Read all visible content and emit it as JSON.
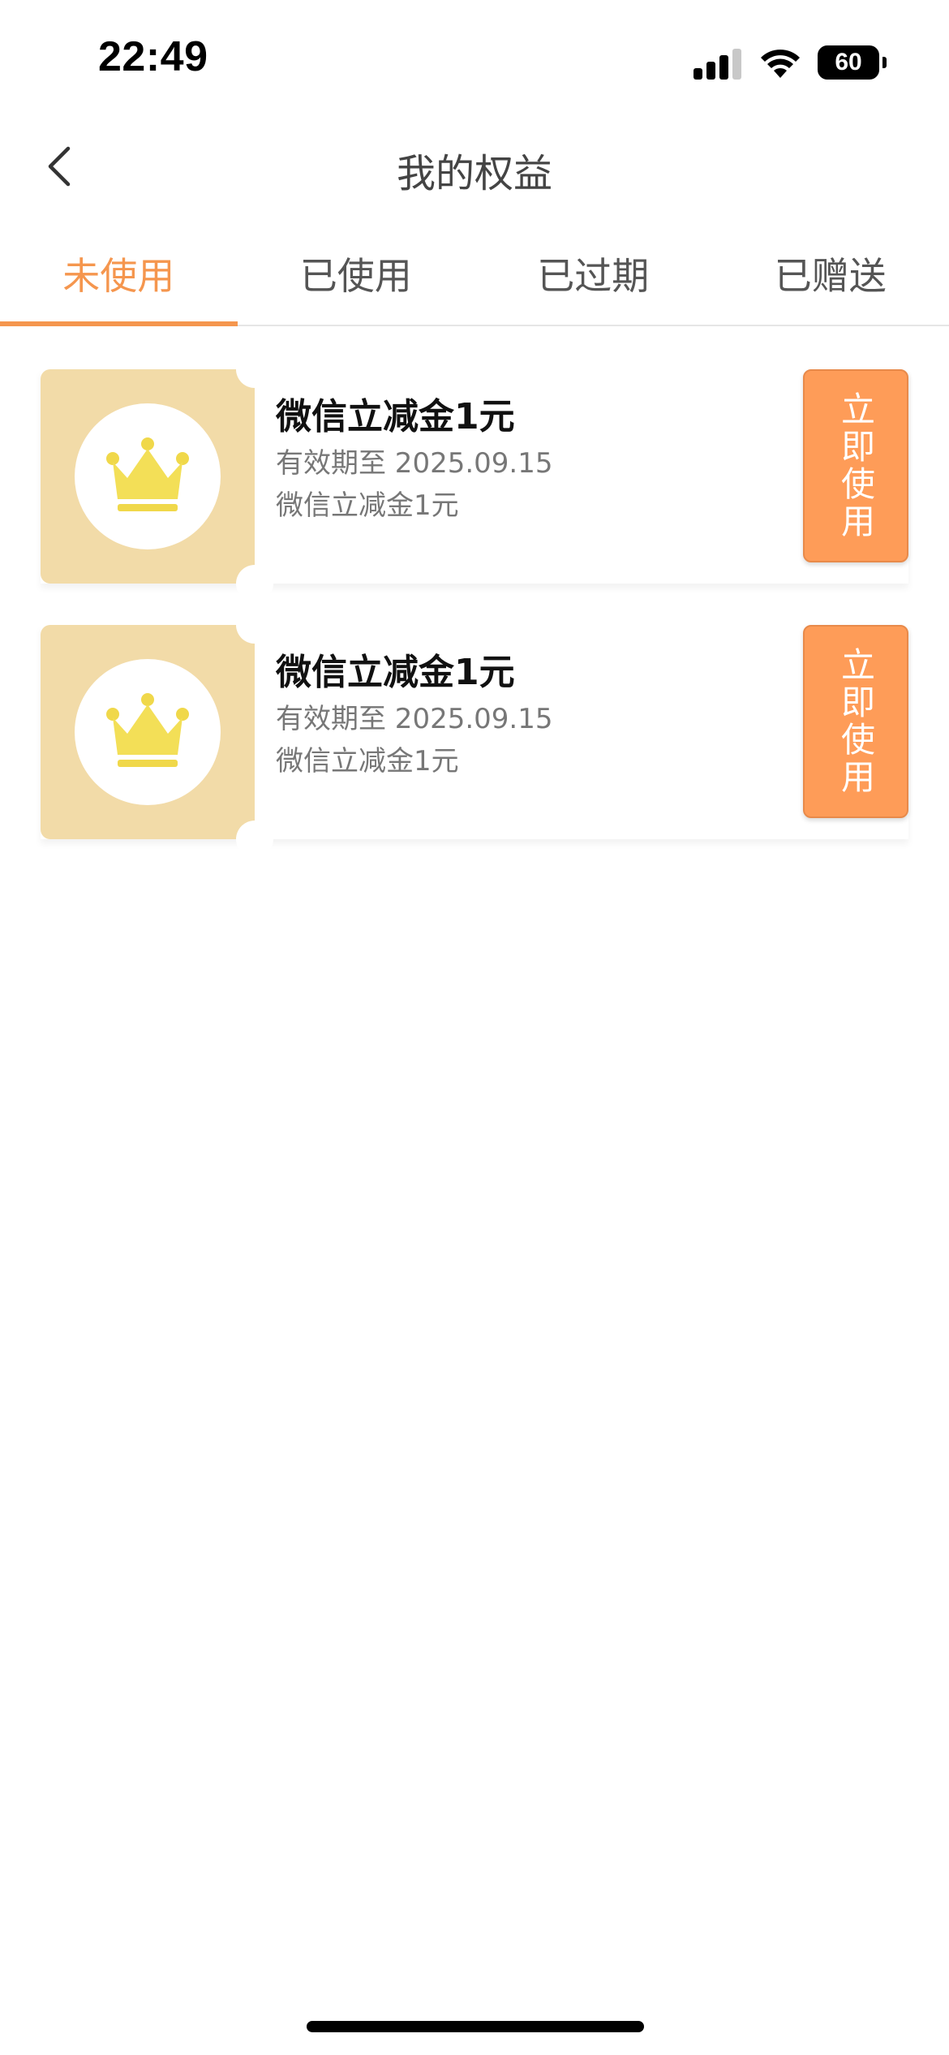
{
  "status_bar": {
    "time": "22:49",
    "battery": "60"
  },
  "nav": {
    "title": "我的权益"
  },
  "tabs": [
    {
      "label": "未使用",
      "active": true
    },
    {
      "label": "已使用",
      "active": false
    },
    {
      "label": "已过期",
      "active": false
    },
    {
      "label": "已赠送",
      "active": false
    }
  ],
  "coupons": [
    {
      "title": "微信立减金1元",
      "expiry": "有效期至 2025.09.15",
      "description": "微信立减金1元",
      "button_label": "立即使用",
      "icon": "crown-icon"
    },
    {
      "title": "微信立减金1元",
      "expiry": "有效期至 2025.09.15",
      "description": "微信立减金1元",
      "button_label": "立即使用",
      "icon": "crown-icon"
    }
  ],
  "colors": {
    "accent": "#f5964e",
    "button": "#fe9c58",
    "coupon_left_bg": "#f2dba8",
    "crown": "#f3df57"
  }
}
